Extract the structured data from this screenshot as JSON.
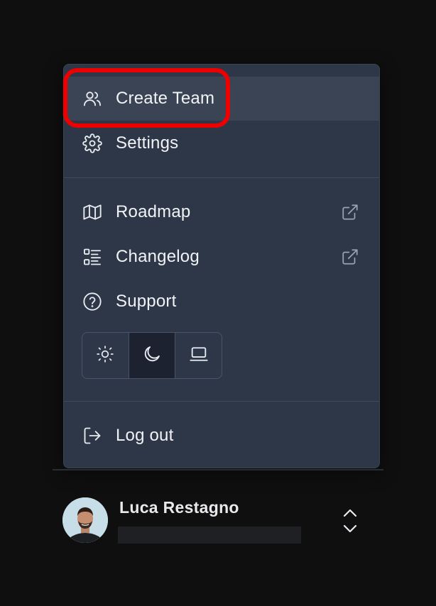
{
  "menu": {
    "items": [
      {
        "label": "Create Team",
        "icon": "users-icon"
      },
      {
        "label": "Settings",
        "icon": "gear-icon"
      },
      {
        "label": "Roadmap",
        "icon": "map-icon",
        "external": true
      },
      {
        "label": "Changelog",
        "icon": "list-icon",
        "external": true
      },
      {
        "label": "Support",
        "icon": "help-circle-icon"
      },
      {
        "label": "Log out",
        "icon": "logout-icon"
      }
    ],
    "theme_options": [
      "light",
      "dark",
      "system"
    ],
    "theme_selected": "dark"
  },
  "user": {
    "name": "Luca Restagno"
  },
  "colors": {
    "menu_bg": "#2d3748",
    "active_bg": "#3b4455",
    "highlight": "#ee0000",
    "page_bg": "#0f0f10"
  }
}
